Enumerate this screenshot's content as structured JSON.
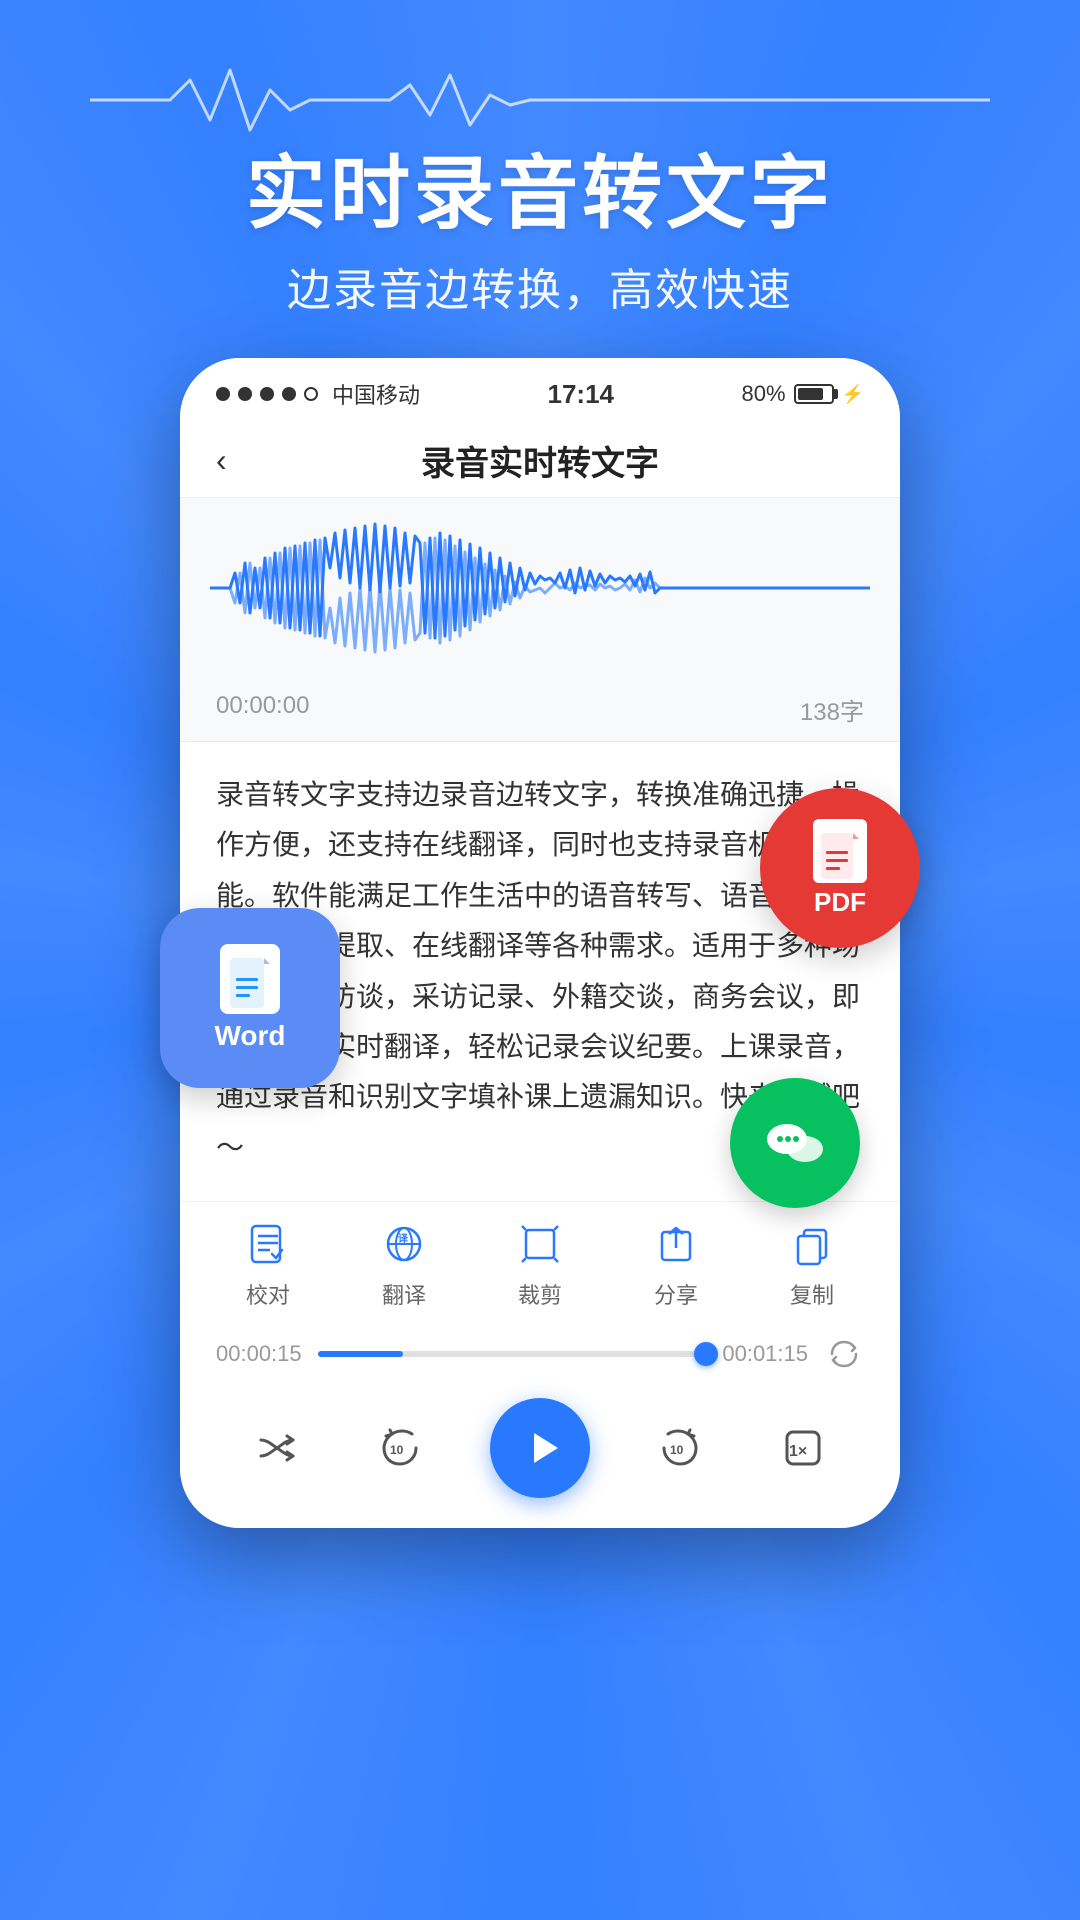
{
  "hero": {
    "title": "实时录音转文字",
    "subtitle": "边录音边转换，高效快速"
  },
  "status_bar": {
    "carrier": "中国移动",
    "time": "17:14",
    "battery": "80%"
  },
  "app": {
    "back_label": "‹",
    "title": "录音实时转文字",
    "timer": "00:00:00",
    "char_count": "138字",
    "transcript": "录音转文字支持边录音边转文字，转换准确迅捷，操作方便，还支持在线翻译，同时也支持录音机的功能。软件能满足工作生活中的语音转写、语音备忘录、文字提取、在线翻译等各种需求。适用于多种场景，会议访谈，采访记录、外籍交谈，商务会议，即刻录音，实时翻译，轻松记录会议纪要。上课录音，通过录音和识别文字填补课上遗漏知识。快来试试吧～"
  },
  "toolbar": {
    "items": [
      {
        "label": "校对",
        "icon": "edit-check-icon"
      },
      {
        "label": "翻译",
        "icon": "translate-icon"
      },
      {
        "label": "裁剪",
        "icon": "crop-icon"
      },
      {
        "label": "分享",
        "icon": "share-icon"
      },
      {
        "label": "复制",
        "icon": "copy-icon"
      }
    ]
  },
  "playback": {
    "time_start": "00:00:15",
    "time_end": "00:01:15",
    "progress_percent": 22,
    "speed_label": "1×"
  },
  "badges": {
    "word_label": "Word",
    "pdf_label": "PDF"
  }
}
